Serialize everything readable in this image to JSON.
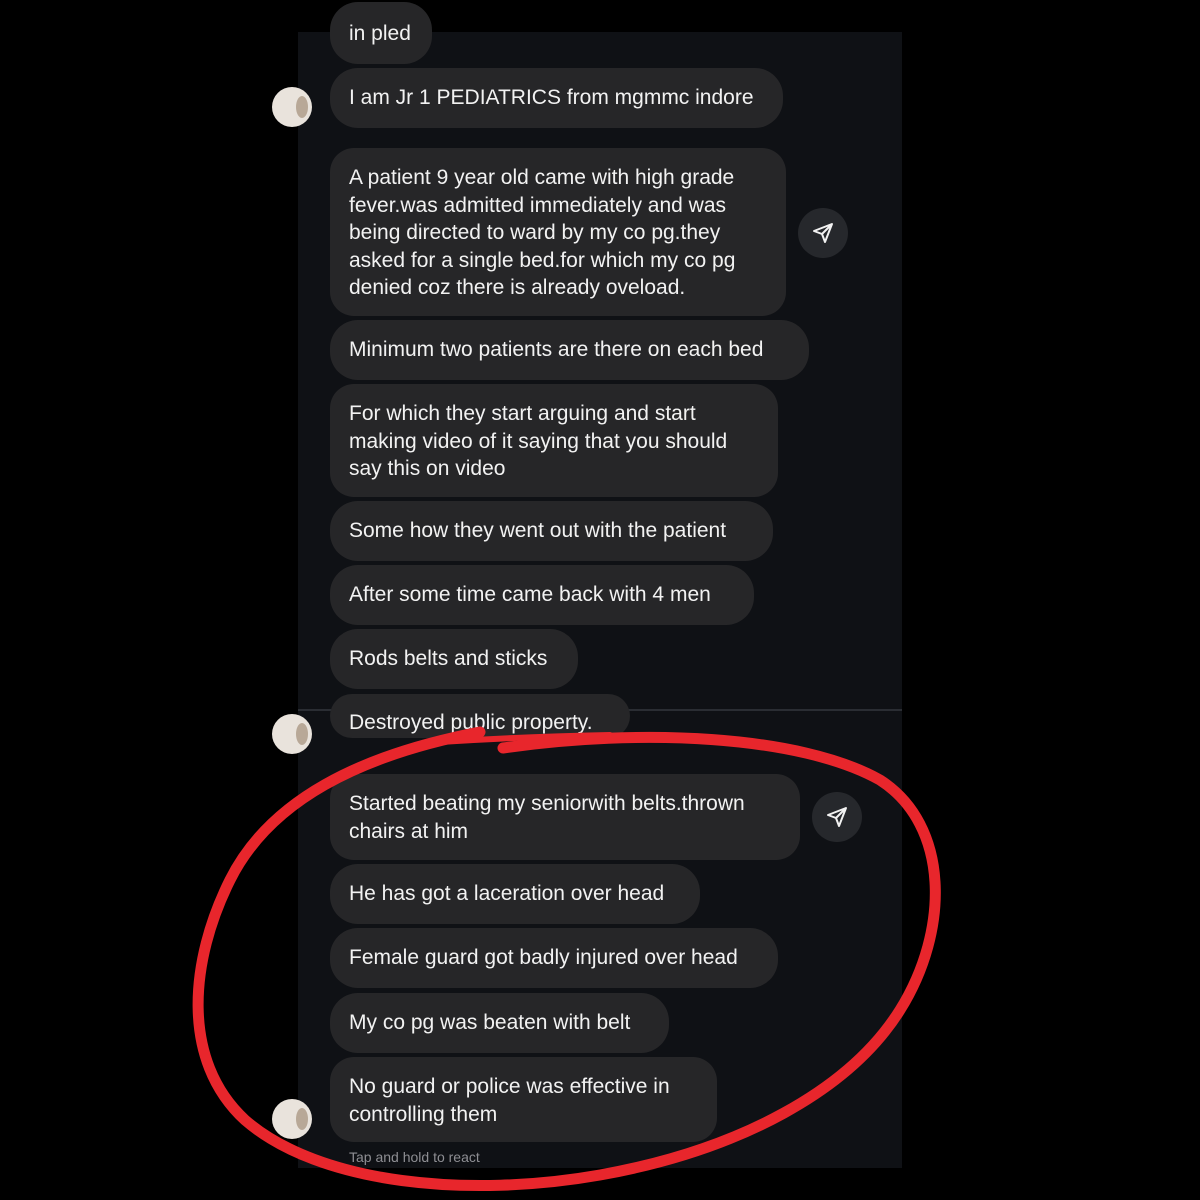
{
  "messages": [
    {
      "text": "in pled"
    },
    {
      "text": "I am Jr 1 PEDIATRICS from mgmmc indore"
    },
    {
      "text": "A patient 9 year old came with high grade\nfever.was admitted immediately and was\nbeing directed to ward by my co pg.they\nasked for a single bed.for which my co pg\ndenied coz there is already oveload."
    },
    {
      "text": "Minimum two patients are there on each bed"
    },
    {
      "text": "For which they start arguing and start\nmaking video of it saying that you should\nsay this on video"
    },
    {
      "text": "Some how they went out with the patient"
    },
    {
      "text": "After some time came back with 4 men"
    },
    {
      "text": "Rods belts and sticks"
    },
    {
      "text": "Destroyed public property."
    },
    {
      "text": "Started beating my seniorwith belts.thrown\nchairs at him"
    },
    {
      "text": "He has got a laceration over head"
    },
    {
      "text": "Female guard got badly injured over head"
    },
    {
      "text": "My co pg was beaten with belt"
    },
    {
      "text": "No guard or police was effective in\ncontrolling them"
    }
  ],
  "hint": "Tap and hold to react",
  "icons": {
    "share": "paper-plane-icon",
    "avatar": "sender-avatar"
  },
  "colors": {
    "background": "#000000",
    "chat_bg": "#0f1115",
    "bubble": "#262628",
    "annotation": "#e8262c"
  }
}
